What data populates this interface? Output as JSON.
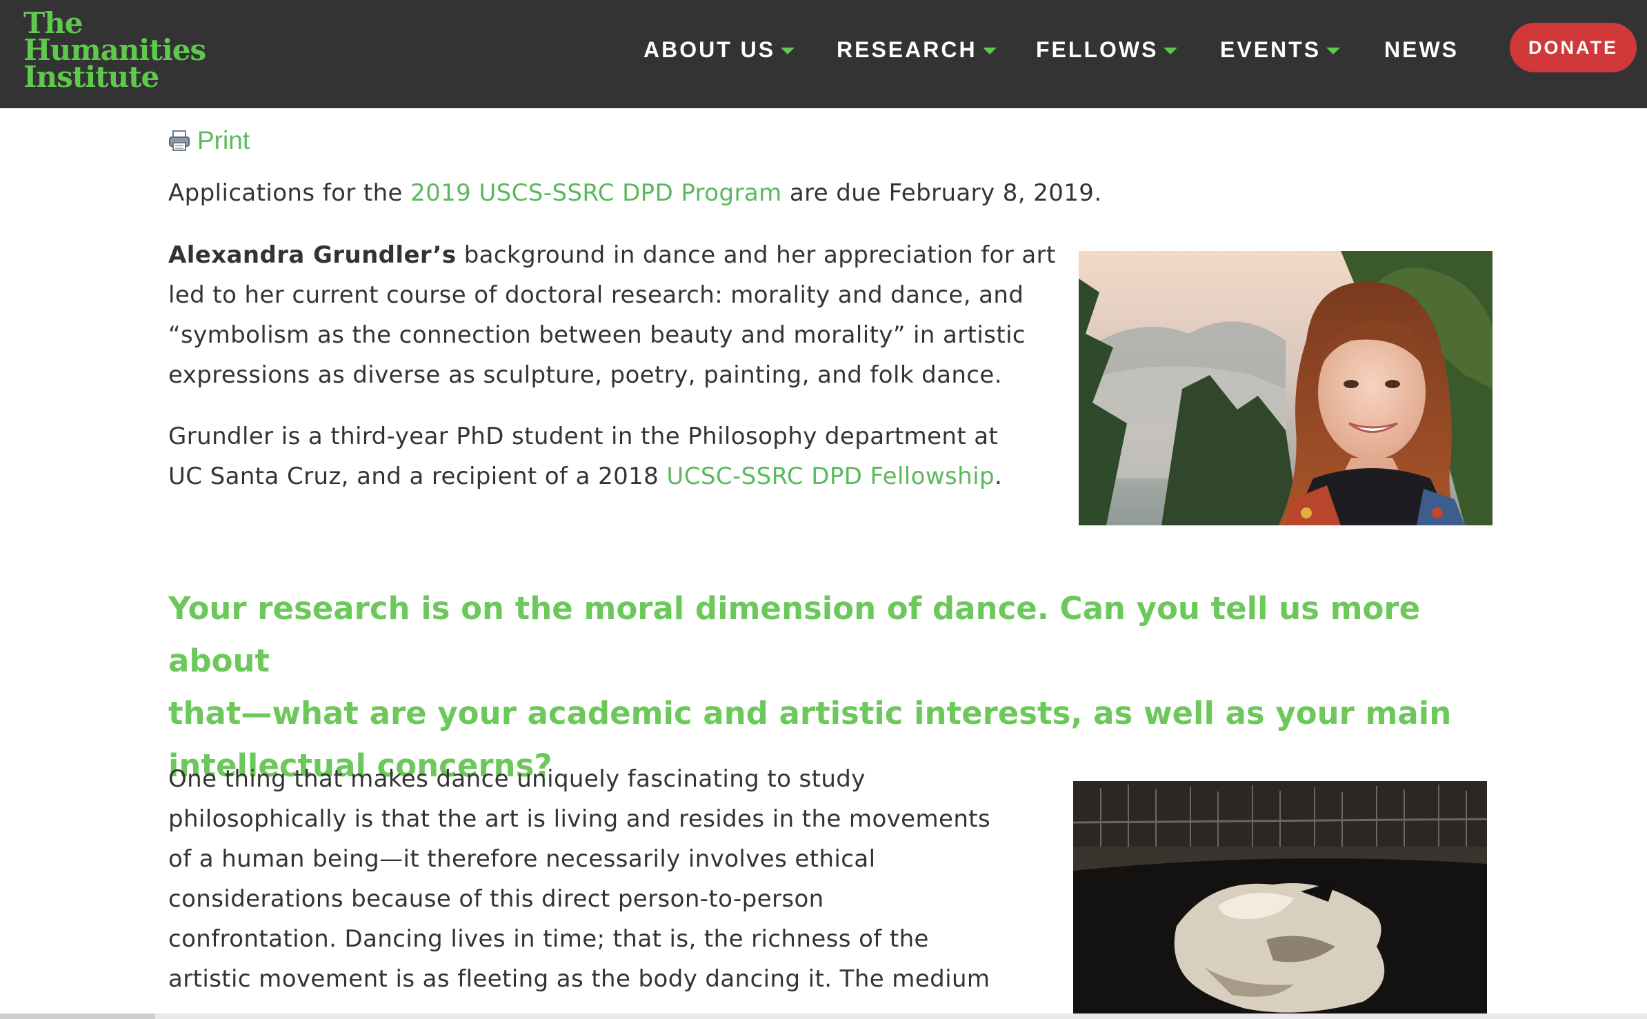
{
  "logo": {
    "lines": [
      "The",
      "Humanities",
      "Institute"
    ]
  },
  "nav": {
    "items": [
      {
        "label": "ABOUT US",
        "has_dropdown": true
      },
      {
        "label": "RESEARCH",
        "has_dropdown": true
      },
      {
        "label": "FELLOWS",
        "has_dropdown": true
      },
      {
        "label": "EVENTS",
        "has_dropdown": true
      },
      {
        "label": "NEWS",
        "has_dropdown": false
      }
    ],
    "donate_label": "DONATE"
  },
  "print": {
    "label": "Print",
    "icon": "printer-icon"
  },
  "intro": {
    "prefix": "Applications for the ",
    "link": "2019 USCS-SSRC DPD Program",
    "suffix": " are due February 8, 2019."
  },
  "bio": {
    "para1": {
      "name": "Alexandra Grundler’s",
      "lines": [
        " background in dance and her appreciation for art",
        "led to her current course of doctoral research: morality and dance, and",
        "“symbolism as the connection between beauty and morality” in artistic",
        "expressions as diverse as sculpture, poetry, painting, and folk dance."
      ]
    },
    "para2": {
      "line1": "Grundler is a third-year PhD student in the Philosophy department at",
      "line2_prefix": "UC Santa Cruz, and a recipient of a 2018 ",
      "line2_link": "UCSC-SSRC DPD Fellowship",
      "line2_suffix": "."
    }
  },
  "question": {
    "lines": [
      "Your research is on the moral dimension of dance. Can you tell us more about",
      "that—what are your academic and artistic interests, as well as your main",
      "intellectual concerns?"
    ]
  },
  "answer": {
    "lines": [
      "One thing that makes dance uniquely fascinating to study",
      "philosophically is that the art is living and resides in the movements",
      "of a human being—it therefore necessarily involves ethical",
      "considerations because of this direct person-to-person",
      "confrontation.  Dancing lives in time; that is, the richness of the",
      "artistic movement is as fleeting as the body dancing it.  The medium"
    ]
  },
  "colors": {
    "header_bg": "#333333",
    "brand_green": "#5ec94d",
    "link_green": "#5cb85c",
    "donate_red": "#d0383a",
    "text": "#333333"
  }
}
